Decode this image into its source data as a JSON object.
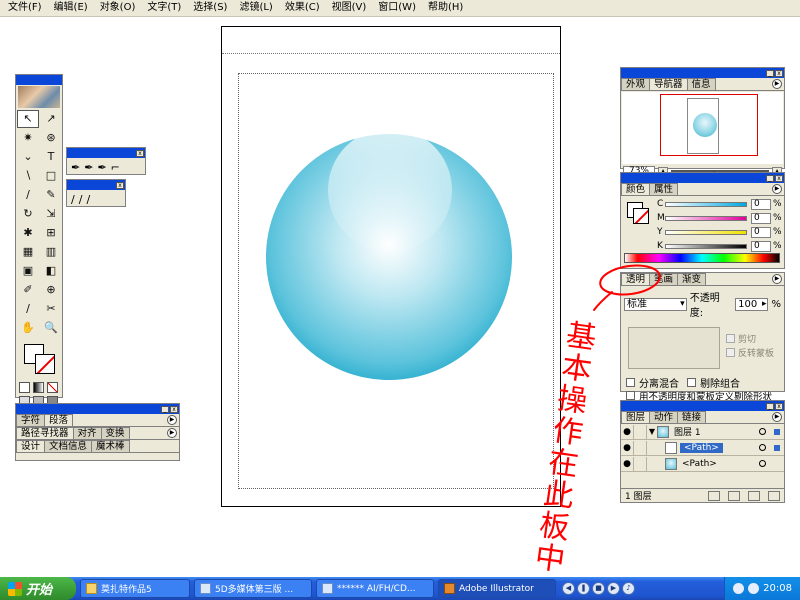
{
  "menu": [
    "文件(F)",
    "编辑(E)",
    "对象(O)",
    "文字(T)",
    "选择(S)",
    "滤镜(L)",
    "效果(C)",
    "视图(V)",
    "窗口(W)",
    "帮助(H)"
  ],
  "toolbox": {
    "tools": [
      "↖",
      "↗",
      "✷",
      "⊛",
      "⌄",
      "T",
      "∖",
      "□",
      "∕",
      "✎",
      "↻",
      "⇲",
      "✱",
      "⊞",
      "▦",
      "▥",
      "▣",
      "◧",
      "✐",
      "⊕",
      "∕",
      "✂",
      "✋",
      "🔍"
    ]
  },
  "flyout_pen": {
    "tools": [
      "✒",
      "✒",
      "✒",
      "⌐"
    ]
  },
  "flyout_brush": {
    "tools": [
      "∕",
      "∕",
      "∕"
    ]
  },
  "text_palettes": {
    "row1": [
      "字符",
      "段落"
    ],
    "row2": [
      "路径寻找器",
      "对齐",
      "变换"
    ],
    "row3": [
      "设计",
      "文档信息",
      "魔术棒"
    ]
  },
  "navigator": {
    "tabs": [
      "外观",
      "导航器",
      "信息"
    ],
    "zoom": "73%"
  },
  "color": {
    "tabs": [
      "颜色",
      "属性"
    ],
    "channels": [
      {
        "label": "C",
        "value": "0",
        "unit": "%",
        "color": "#00a8e0"
      },
      {
        "label": "M",
        "value": "0",
        "unit": "%",
        "color": "#e0009a"
      },
      {
        "label": "Y",
        "value": "0",
        "unit": "%",
        "color": "#f0e000"
      },
      {
        "label": "K",
        "value": "0",
        "unit": "%",
        "color": "#000000"
      }
    ]
  },
  "transparency": {
    "tabs": [
      "透明",
      "笔画",
      "渐变"
    ],
    "mode": "标准",
    "opacity_label": "不透明度:",
    "opacity_value": "100",
    "opacity_unit": "%",
    "clip": "剪切",
    "invert_mask": "反转蒙板",
    "isolate_blending": "分离混合",
    "knockout_group": "剔除组合",
    "opacity_mask_knockout": "用不透明度和蒙板定义剔除形状"
  },
  "layers": {
    "tabs": [
      "图层",
      "动作",
      "链接"
    ],
    "items": [
      {
        "name": "图层 1",
        "selected": false
      },
      {
        "name": "<Path>",
        "selected": true
      },
      {
        "name": "<Path>",
        "selected": false
      }
    ],
    "count": "1 图层"
  },
  "annotation_text": "基本操作在此板中。",
  "taskbar": {
    "start": "开始",
    "tasks": [
      "莫扎特作品5",
      "5D多媒体第三版 ...",
      "****** AI/FH/CD...",
      "Adobe Illustrator"
    ],
    "time": "20:08"
  },
  "colors": {
    "accent": "#0a46d8",
    "sphere_light": "#e9f7fb",
    "sphere_dark": "#1aa7c9",
    "annotation": "#ff0000"
  }
}
